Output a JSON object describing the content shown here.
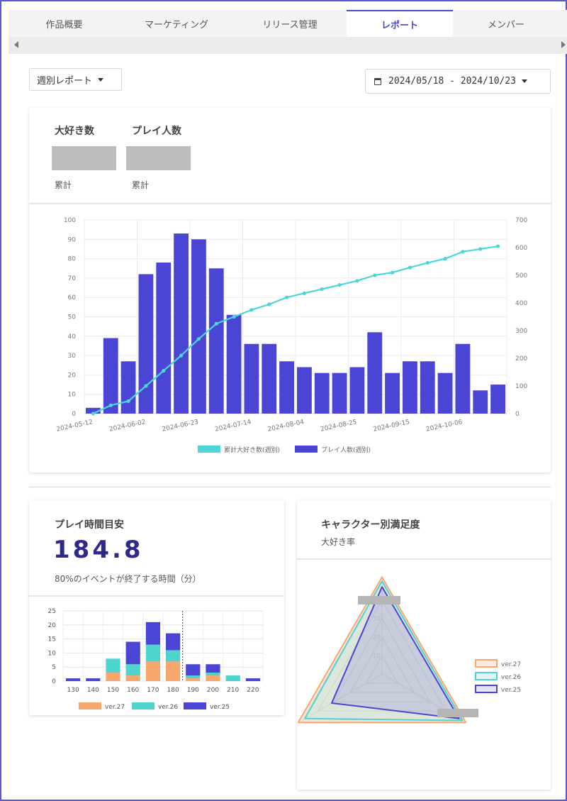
{
  "tabs": [
    {
      "label": "作品概要",
      "active": false
    },
    {
      "label": "マーケティング",
      "active": false
    },
    {
      "label": "リリース管理",
      "active": false
    },
    {
      "label": "レポート",
      "active": true
    },
    {
      "label": "メンバー",
      "active": false
    }
  ],
  "controls": {
    "report_type": "週別レポート",
    "date_range": "2024/05/18 - 2024/10/23"
  },
  "summary": {
    "favorites_title": "大好き数",
    "players_title": "プレイ人数",
    "favorites_sub": "累計",
    "players_sub": "累計"
  },
  "main_chart": {
    "legend_line": "累計大好き数(週別)",
    "legend_bar": "プレイ人数(週別)",
    "x_ticks": [
      "2024-05-12",
      "2024-06-02",
      "2024-06-23",
      "2024-07-14",
      "2024-08-04",
      "2024-08-25",
      "2024-09-15",
      "2024-10-06"
    ],
    "y_left_ticks": [
      "0",
      "10",
      "20",
      "30",
      "40",
      "50",
      "60",
      "70",
      "80",
      "90",
      "100"
    ],
    "y_right_ticks": [
      "0",
      "100",
      "200",
      "300",
      "400",
      "500",
      "600",
      "700"
    ]
  },
  "playtime": {
    "title": "プレイ時間目安",
    "value": "184.8",
    "caption": "80%のイベントが終了する時間（分）"
  },
  "satisfaction": {
    "title": "キャラクター別満足度",
    "subtitle": "大好き率",
    "legend": [
      "ver.27",
      "ver.26",
      "ver.25"
    ],
    "radial_ticks": [
      "10",
      "20",
      "30",
      "40"
    ]
  },
  "colors": {
    "accent": "#4b45cf",
    "bar": "#4b45d6",
    "line": "#4dd6d6",
    "v27": "#f7a66e",
    "v26": "#4fd3cf",
    "v25": "#4b45d6"
  },
  "chart_data": [
    {
      "type": "bar",
      "title": "",
      "x_ticks": [
        "2024-05-12",
        "2024-06-02",
        "2024-06-23",
        "2024-07-14",
        "2024-08-04",
        "2024-08-25",
        "2024-09-15",
        "2024-10-06"
      ],
      "series": [
        {
          "name": "プレイ人数(週別)",
          "axis": "left",
          "kind": "bar",
          "values": [
            3,
            39,
            27,
            72,
            78,
            93,
            90,
            75,
            51,
            36,
            36,
            27,
            24,
            21,
            21,
            24,
            42,
            21,
            27,
            27,
            21,
            36,
            12,
            15
          ]
        },
        {
          "name": "累計大好き数(週別)",
          "axis": "right",
          "kind": "line",
          "values": [
            0,
            30,
            45,
            100,
            155,
            210,
            270,
            325,
            350,
            375,
            395,
            420,
            435,
            450,
            465,
            480,
            500,
            510,
            528,
            545,
            560,
            585,
            595,
            605
          ]
        }
      ],
      "ylim_left": [
        0,
        100
      ],
      "ylim_right": [
        0,
        700
      ]
    },
    {
      "type": "bar",
      "title": "",
      "categories": [
        "130",
        "140",
        "150",
        "160",
        "170",
        "180",
        "190",
        "200",
        "210",
        "220"
      ],
      "stacked": true,
      "series": [
        {
          "name": "ver.27",
          "values": [
            0,
            0,
            3,
            2,
            7,
            7,
            1,
            2,
            0,
            0
          ]
        },
        {
          "name": "ver.26",
          "values": [
            0,
            0,
            5,
            4,
            6,
            4,
            1,
            1,
            2,
            0
          ]
        },
        {
          "name": "ver.25",
          "values": [
            1,
            1,
            0,
            8,
            8,
            6,
            4,
            3,
            0,
            1
          ]
        }
      ],
      "ylim": [
        0,
        25
      ],
      "y_ticks": [
        "0",
        "5",
        "10",
        "15",
        "20",
        "25"
      ],
      "marker_x": "184.8"
    },
    {
      "type": "radar",
      "title": "",
      "series": [
        {
          "name": "ver.27",
          "values": [
            50,
            50,
            50
          ]
        },
        {
          "name": "ver.26",
          "values": [
            48,
            46,
            48
          ]
        },
        {
          "name": "ver.25",
          "values": [
            45,
            30,
            46
          ]
        }
      ],
      "r_ticks": [
        "10",
        "20",
        "30",
        "40"
      ]
    }
  ]
}
